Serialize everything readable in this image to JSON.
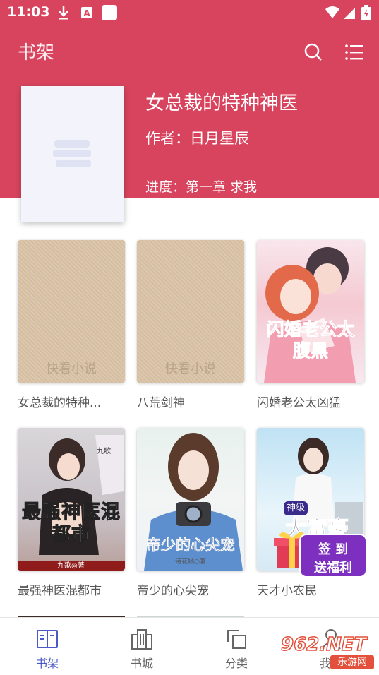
{
  "status_bar": {
    "time": "11:03"
  },
  "app_bar": {
    "title": "书架",
    "search_icon": "search-icon",
    "menu_icon": "list-menu-icon"
  },
  "featured": {
    "title": "女总裁的特种神医",
    "author": "作者：日月星辰",
    "progress": "进度：第一章 求我"
  },
  "books": [
    {
      "title": "女总裁的特种...",
      "cover_text": "快看小说"
    },
    {
      "title": "八荒剑神",
      "cover_text": "快看小说"
    },
    {
      "title": "闪婚老公太凶猛",
      "cover_text": "闪婚老公太腹黑"
    },
    {
      "title": "最强神医混都市",
      "cover_text": "最强神医混都市",
      "cover_sub": "九歌",
      "cover_tag": "九歌◎著"
    },
    {
      "title": "帝少的心尖宠",
      "cover_text": "帝少的心尖宠",
      "cover_sub": "诗花嫣○著"
    },
    {
      "title": "天才小农民",
      "cover_text": "大富豪",
      "cover_sub": "神级"
    }
  ],
  "promo": {
    "line1": "签 到",
    "line2": "送福利"
  },
  "bottom_nav": [
    {
      "label": "书架",
      "icon": "book-open-icon",
      "active": true
    },
    {
      "label": "书城",
      "icon": "city-icon",
      "active": false
    },
    {
      "label": "分类",
      "icon": "category-icon",
      "active": false
    },
    {
      "label": "我的",
      "icon": "person-icon",
      "active": false
    }
  ],
  "watermark": {
    "text": "962.NET",
    "sub": "乐游网"
  },
  "colors": {
    "primary": "#d8445e",
    "nav_active": "#4a59c7"
  }
}
